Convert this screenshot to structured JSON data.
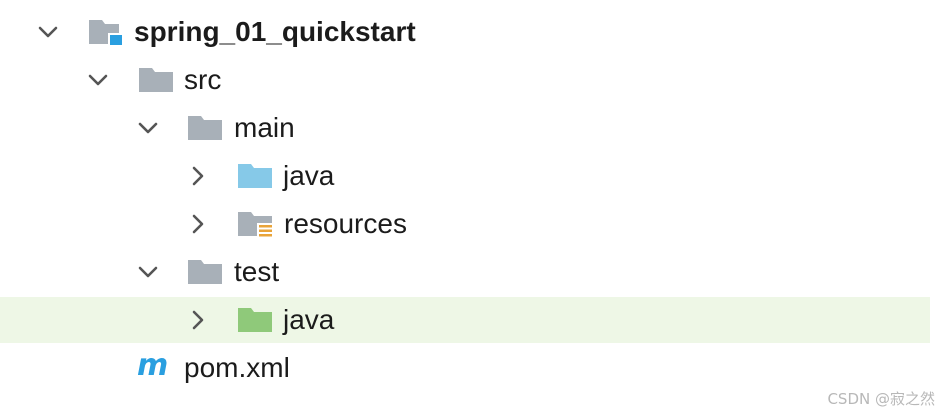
{
  "tree": {
    "rows": [
      {
        "label": "spring_01_quickstart",
        "icon": "project-folder-icon",
        "expanded": true,
        "depth": 0,
        "bold": true
      },
      {
        "label": "src",
        "icon": "folder-icon",
        "expanded": true,
        "depth": 1
      },
      {
        "label": "main",
        "icon": "folder-icon",
        "expanded": true,
        "depth": 2
      },
      {
        "label": "java",
        "icon": "source-root-folder-icon",
        "expanded": false,
        "depth": 3
      },
      {
        "label": "resources",
        "icon": "resources-root-folder-icon",
        "expanded": false,
        "depth": 3
      },
      {
        "label": "test",
        "icon": "folder-icon",
        "expanded": true,
        "depth": 2
      },
      {
        "label": "java",
        "icon": "test-root-folder-icon",
        "expanded": false,
        "depth": 3,
        "selected": true
      },
      {
        "label": "pom.xml",
        "icon": "maven-icon",
        "depth": 2
      }
    ]
  },
  "colors": {
    "folder_gray": "#a8b0b8",
    "source_blue": "#86c9e8",
    "test_green": "#8fc97a",
    "maven_blue": "#2a9fe0",
    "selection_bg": "#eef7e6"
  },
  "watermark": "CSDN @寂之然"
}
